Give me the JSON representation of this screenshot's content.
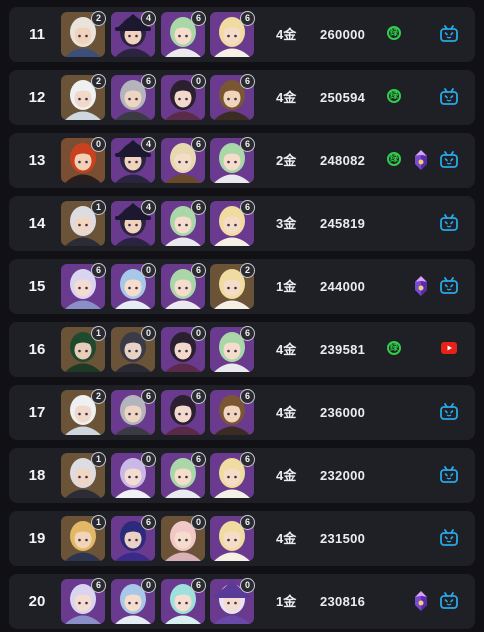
{
  "gold_unit": "金",
  "rows": [
    {
      "rank": "11",
      "characters": [
        {
          "portrait": "pale-hair-girl",
          "cons": "2",
          "bg": "#6b5338"
        },
        {
          "portrait": "witch-hat-girl",
          "cons": "4",
          "bg": "#6a3a8e"
        },
        {
          "portrait": "green-hair-girl",
          "cons": "6",
          "bg": "#6a3a8e"
        },
        {
          "portrait": "blonde-traveler",
          "cons": "6",
          "bg": "#6a3a8e"
        }
      ],
      "gold": "4",
      "score": "260000",
      "green_tag": "绿",
      "gem": false,
      "bilibili": true,
      "youtube": false
    },
    {
      "rank": "12",
      "characters": [
        {
          "portrait": "white-hair-lady",
          "cons": "2",
          "bg": "#6b5338"
        },
        {
          "portrait": "grey-hair-man",
          "cons": "6",
          "bg": "#6a3a8e"
        },
        {
          "portrait": "cat-ear-girl",
          "cons": "0",
          "bg": "#6a3a8e"
        },
        {
          "portrait": "brown-hair-boy",
          "cons": "6",
          "bg": "#6a3a8e"
        }
      ],
      "gold": "4",
      "score": "250594",
      "green_tag": "绿",
      "gem": false,
      "bilibili": true,
      "youtube": false
    },
    {
      "rank": "13",
      "characters": [
        {
          "portrait": "red-hair-girl",
          "cons": "0",
          "bg": "#7a4e33"
        },
        {
          "portrait": "witch-hat-girl",
          "cons": "4",
          "bg": "#6a3a8e"
        },
        {
          "portrait": "skull-mask-girl",
          "cons": "6",
          "bg": "#6a3a8e"
        },
        {
          "portrait": "green-hair-girl",
          "cons": "6",
          "bg": "#6a3a8e"
        }
      ],
      "gold": "2",
      "score": "248082",
      "green_tag": "绿",
      "gem": true,
      "bilibili": true,
      "youtube": false
    },
    {
      "rank": "14",
      "characters": [
        {
          "portrait": "silver-hair-boy",
          "cons": "1",
          "bg": "#6b5338"
        },
        {
          "portrait": "witch-hat-girl",
          "cons": "4",
          "bg": "#6a3a8e"
        },
        {
          "portrait": "green-hair-girl",
          "cons": "6",
          "bg": "#6a3a8e"
        },
        {
          "portrait": "blonde-traveler",
          "cons": "6",
          "bg": "#6a3a8e"
        }
      ],
      "gold": "3",
      "score": "245819",
      "green_tag": "",
      "gem": false,
      "bilibili": true,
      "youtube": false
    },
    {
      "rank": "15",
      "characters": [
        {
          "portrait": "lavender-hair-girl",
          "cons": "6",
          "bg": "#6a3a8e"
        },
        {
          "portrait": "blue-hair-girl",
          "cons": "0",
          "bg": "#6a3a8e"
        },
        {
          "portrait": "green-hair-girl",
          "cons": "6",
          "bg": "#6a3a8e"
        },
        {
          "portrait": "blonde-traveler",
          "cons": "2",
          "bg": "#6b5338"
        }
      ],
      "gold": "1",
      "score": "244000",
      "green_tag": "",
      "gem": true,
      "bilibili": true,
      "youtube": false
    },
    {
      "rank": "16",
      "characters": [
        {
          "portrait": "green-veiled-lady",
          "cons": "1",
          "bg": "#6b5338"
        },
        {
          "portrait": "dark-hair-elf",
          "cons": "0",
          "bg": "#6b5338"
        },
        {
          "portrait": "cat-ear-girl",
          "cons": "0",
          "bg": "#6a3a8e"
        },
        {
          "portrait": "green-hair-girl",
          "cons": "6",
          "bg": "#6a3a8e"
        }
      ],
      "gold": "4",
      "score": "239581",
      "green_tag": "绿",
      "gem": false,
      "bilibili": false,
      "youtube": true
    },
    {
      "rank": "17",
      "characters": [
        {
          "portrait": "white-hair-lady",
          "cons": "2",
          "bg": "#6b5338"
        },
        {
          "portrait": "grey-hair-man",
          "cons": "6",
          "bg": "#6a3a8e"
        },
        {
          "portrait": "cat-ear-girl",
          "cons": "6",
          "bg": "#6a3a8e"
        },
        {
          "portrait": "brown-hair-boy",
          "cons": "6",
          "bg": "#6a3a8e"
        }
      ],
      "gold": "4",
      "score": "236000",
      "green_tag": "",
      "gem": false,
      "bilibili": true,
      "youtube": false
    },
    {
      "rank": "18",
      "characters": [
        {
          "portrait": "silver-hair-boy",
          "cons": "1",
          "bg": "#6b5338"
        },
        {
          "portrait": "lilac-hair-girl",
          "cons": "0",
          "bg": "#6a3a8e"
        },
        {
          "portrait": "green-hair-girl",
          "cons": "6",
          "bg": "#6a3a8e"
        },
        {
          "portrait": "blonde-traveler",
          "cons": "6",
          "bg": "#6a3a8e"
        }
      ],
      "gold": "4",
      "score": "232000",
      "green_tag": "",
      "gem": false,
      "bilibili": true,
      "youtube": false
    },
    {
      "rank": "19",
      "characters": [
        {
          "portrait": "blonde-boy",
          "cons": "1",
          "bg": "#6b5338"
        },
        {
          "portrait": "indigo-hair-boy",
          "cons": "6",
          "bg": "#6a3a8e"
        },
        {
          "portrait": "pink-hair-girl",
          "cons": "0",
          "bg": "#6b5338"
        },
        {
          "portrait": "blonde-traveler",
          "cons": "6",
          "bg": "#6a3a8e"
        }
      ],
      "gold": "4",
      "score": "231500",
      "green_tag": "",
      "gem": false,
      "bilibili": true,
      "youtube": false
    },
    {
      "rank": "20",
      "characters": [
        {
          "portrait": "lavender-hair-girl",
          "cons": "6",
          "bg": "#6a3a8e"
        },
        {
          "portrait": "blue-hair-girl",
          "cons": "0",
          "bg": "#6a3a8e"
        },
        {
          "portrait": "teal-hair-girl",
          "cons": "6",
          "bg": "#6a3a8e"
        },
        {
          "portrait": "violet-hat-girl",
          "cons": "0",
          "bg": "#6a3a8e"
        }
      ],
      "gold": "1",
      "score": "230816",
      "green_tag": "",
      "gem": true,
      "bilibili": true,
      "youtube": false
    }
  ],
  "portrait_colors": {
    "pale-hair-girl": {
      "hair": "#e8e4dc",
      "skin": "#f1d3bb",
      "outfit": "#3b4f7a"
    },
    "witch-hat-girl": {
      "hair": "#2a2440",
      "skin": "#f0d2bd",
      "outfit": "#2b2440",
      "hat": "#1b1830"
    },
    "green-hair-girl": {
      "hair": "#a9d7a8",
      "skin": "#f5dccb",
      "outfit": "#e9e9ee"
    },
    "blonde-traveler": {
      "hair": "#f0dba0",
      "skin": "#f5dcc6",
      "outfit": "#f4f0e4"
    },
    "white-hair-lady": {
      "hair": "#eef0f2",
      "skin": "#f2d8c8",
      "outfit": "#cfd6de"
    },
    "grey-hair-man": {
      "hair": "#b4b4bc",
      "skin": "#eed5c2",
      "outfit": "#3a3a44"
    },
    "cat-ear-girl": {
      "hair": "#2b2030",
      "skin": "#f3d9cc",
      "outfit": "#5a2a48"
    },
    "brown-hair-boy": {
      "hair": "#7a5633",
      "skin": "#f1d4bc",
      "outfit": "#3a2c22"
    },
    "red-hair-girl": {
      "hair": "#c9411e",
      "skin": "#f2cfb5",
      "outfit": "#2a1e1c"
    },
    "skull-mask-girl": {
      "hair": "#e8d8b0",
      "skin": "#f3ddc8",
      "outfit": "#6a4a2a"
    },
    "silver-hair-boy": {
      "hair": "#dcdce2",
      "skin": "#f2d6c4",
      "outfit": "#2c2c36"
    },
    "lavender-hair-girl": {
      "hair": "#d9d4f0",
      "skin": "#f5dcd0",
      "outfit": "#8b8fc8"
    },
    "blue-hair-girl": {
      "hair": "#a8c8ea",
      "skin": "#f5dccb",
      "outfit": "#e6ecf4"
    },
    "green-veiled-lady": {
      "hair": "#1f4a2e",
      "skin": "#e8cdb8",
      "outfit": "#1c3a24"
    },
    "dark-hair-elf": {
      "hair": "#3a3a48",
      "skin": "#e8d2c4",
      "outfit": "#2a2a34"
    },
    "lilac-hair-girl": {
      "hair": "#c9b8e8",
      "skin": "#f5dcd0",
      "outfit": "#f0eef6"
    },
    "blonde-boy": {
      "hair": "#e2b866",
      "skin": "#f2d4b8",
      "outfit": "#2c3450"
    },
    "indigo-hair-boy": {
      "hair": "#2c2a7a",
      "skin": "#ecd0c4",
      "outfit": "#3a2a8a"
    },
    "pink-hair-girl": {
      "hair": "#f2c7c8",
      "skin": "#f5dccb",
      "outfit": "#d8b0b8"
    },
    "teal-hair-girl": {
      "hair": "#9ee0dc",
      "skin": "#f5ddd0",
      "outfit": "#d8f0f0"
    },
    "violet-hat-girl": {
      "hair": "#e8e4f2",
      "skin": "#f5dcd0",
      "outfit": "#6a4aa8",
      "hat": "#5a3a98"
    }
  },
  "colors": {
    "bilibili": "#29a8e6",
    "youtube": "#e62117",
    "green_tag": "#2fcf4a",
    "gem": "#7a4ad0"
  }
}
